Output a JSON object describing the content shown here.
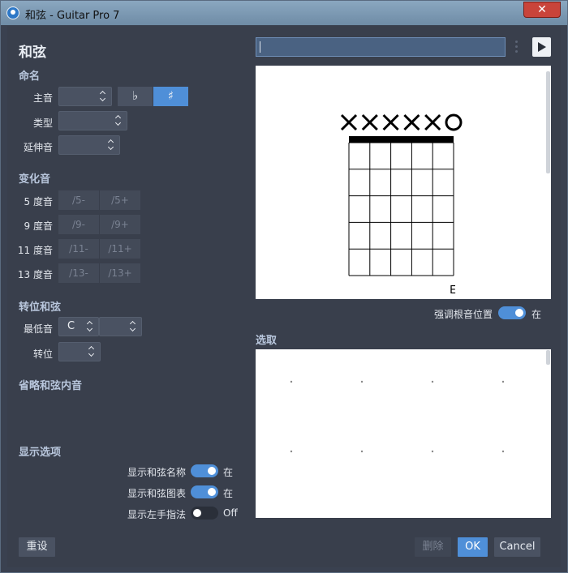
{
  "window": {
    "title": "和弦 - Guitar Pro 7"
  },
  "left": {
    "heading": "和弦",
    "naming": {
      "title": "命名",
      "root_label": "主音",
      "type_label": "类型",
      "ext_label": "延伸音",
      "flat_symbol": "♭",
      "sharp_symbol": "♯"
    },
    "alterations": {
      "title": "变化音",
      "rows": [
        {
          "label": "5 度音",
          "minus": "/5-",
          "plus": "/5+"
        },
        {
          "label": "9 度音",
          "minus": "/9-",
          "plus": "/9+"
        },
        {
          "label": "11 度音",
          "minus": "/11-",
          "plus": "/11+"
        },
        {
          "label": "13 度音",
          "minus": "/13-",
          "plus": "/13+"
        }
      ]
    },
    "inversion": {
      "title": "转位和弦",
      "bass_label": "最低音",
      "bass_value": "C",
      "inv_label": "转位"
    },
    "omit": {
      "title": "省略和弦内音"
    },
    "display": {
      "title": "显示选项",
      "items": [
        {
          "label": "显示和弦名称",
          "state": "在"
        },
        {
          "label": "显示和弦图表",
          "state": "在"
        },
        {
          "label": "显示左手指法",
          "state": "Off"
        }
      ]
    }
  },
  "right": {
    "diagram": {
      "string_markers": [
        "×",
        "×",
        "×",
        "×",
        "×",
        "○"
      ],
      "bottom_note": "E"
    },
    "emphasize_root": {
      "label": "强调根音位置",
      "state": "在"
    },
    "selection_title": "选取"
  },
  "buttons": {
    "reset": "重设",
    "delete": "删除",
    "ok": "OK",
    "cancel": "Cancel"
  },
  "colors": {
    "accent": "#4f8fd8",
    "background": "#393f4c"
  },
  "icons": {
    "close": "close-icon",
    "play": "play-icon",
    "app": "guitar-pro-icon"
  }
}
